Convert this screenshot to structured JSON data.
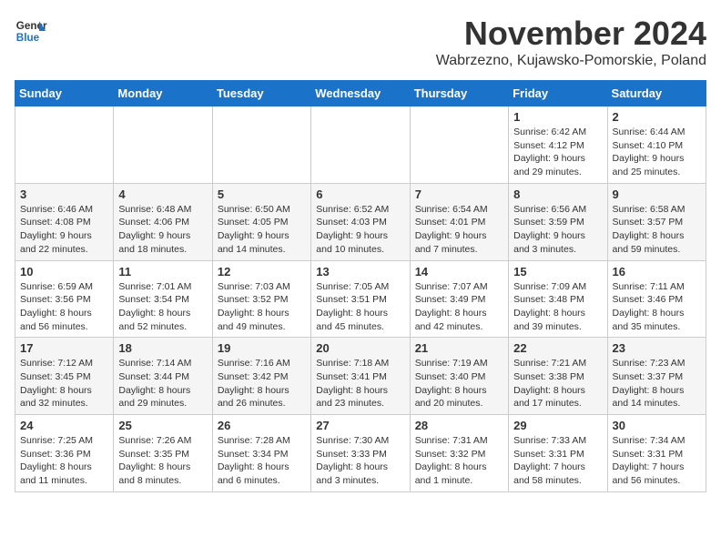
{
  "logo": {
    "line1": "General",
    "line2": "Blue"
  },
  "title": "November 2024",
  "location": "Wabrzezno, Kujawsko-Pomorskie, Poland",
  "weekdays": [
    "Sunday",
    "Monday",
    "Tuesday",
    "Wednesday",
    "Thursday",
    "Friday",
    "Saturday"
  ],
  "weeks": [
    [
      {
        "day": "",
        "info": ""
      },
      {
        "day": "",
        "info": ""
      },
      {
        "day": "",
        "info": ""
      },
      {
        "day": "",
        "info": ""
      },
      {
        "day": "",
        "info": ""
      },
      {
        "day": "1",
        "info": "Sunrise: 6:42 AM\nSunset: 4:12 PM\nDaylight: 9 hours and 29 minutes."
      },
      {
        "day": "2",
        "info": "Sunrise: 6:44 AM\nSunset: 4:10 PM\nDaylight: 9 hours and 25 minutes."
      }
    ],
    [
      {
        "day": "3",
        "info": "Sunrise: 6:46 AM\nSunset: 4:08 PM\nDaylight: 9 hours and 22 minutes."
      },
      {
        "day": "4",
        "info": "Sunrise: 6:48 AM\nSunset: 4:06 PM\nDaylight: 9 hours and 18 minutes."
      },
      {
        "day": "5",
        "info": "Sunrise: 6:50 AM\nSunset: 4:05 PM\nDaylight: 9 hours and 14 minutes."
      },
      {
        "day": "6",
        "info": "Sunrise: 6:52 AM\nSunset: 4:03 PM\nDaylight: 9 hours and 10 minutes."
      },
      {
        "day": "7",
        "info": "Sunrise: 6:54 AM\nSunset: 4:01 PM\nDaylight: 9 hours and 7 minutes."
      },
      {
        "day": "8",
        "info": "Sunrise: 6:56 AM\nSunset: 3:59 PM\nDaylight: 9 hours and 3 minutes."
      },
      {
        "day": "9",
        "info": "Sunrise: 6:58 AM\nSunset: 3:57 PM\nDaylight: 8 hours and 59 minutes."
      }
    ],
    [
      {
        "day": "10",
        "info": "Sunrise: 6:59 AM\nSunset: 3:56 PM\nDaylight: 8 hours and 56 minutes."
      },
      {
        "day": "11",
        "info": "Sunrise: 7:01 AM\nSunset: 3:54 PM\nDaylight: 8 hours and 52 minutes."
      },
      {
        "day": "12",
        "info": "Sunrise: 7:03 AM\nSunset: 3:52 PM\nDaylight: 8 hours and 49 minutes."
      },
      {
        "day": "13",
        "info": "Sunrise: 7:05 AM\nSunset: 3:51 PM\nDaylight: 8 hours and 45 minutes."
      },
      {
        "day": "14",
        "info": "Sunrise: 7:07 AM\nSunset: 3:49 PM\nDaylight: 8 hours and 42 minutes."
      },
      {
        "day": "15",
        "info": "Sunrise: 7:09 AM\nSunset: 3:48 PM\nDaylight: 8 hours and 39 minutes."
      },
      {
        "day": "16",
        "info": "Sunrise: 7:11 AM\nSunset: 3:46 PM\nDaylight: 8 hours and 35 minutes."
      }
    ],
    [
      {
        "day": "17",
        "info": "Sunrise: 7:12 AM\nSunset: 3:45 PM\nDaylight: 8 hours and 32 minutes."
      },
      {
        "day": "18",
        "info": "Sunrise: 7:14 AM\nSunset: 3:44 PM\nDaylight: 8 hours and 29 minutes."
      },
      {
        "day": "19",
        "info": "Sunrise: 7:16 AM\nSunset: 3:42 PM\nDaylight: 8 hours and 26 minutes."
      },
      {
        "day": "20",
        "info": "Sunrise: 7:18 AM\nSunset: 3:41 PM\nDaylight: 8 hours and 23 minutes."
      },
      {
        "day": "21",
        "info": "Sunrise: 7:19 AM\nSunset: 3:40 PM\nDaylight: 8 hours and 20 minutes."
      },
      {
        "day": "22",
        "info": "Sunrise: 7:21 AM\nSunset: 3:38 PM\nDaylight: 8 hours and 17 minutes."
      },
      {
        "day": "23",
        "info": "Sunrise: 7:23 AM\nSunset: 3:37 PM\nDaylight: 8 hours and 14 minutes."
      }
    ],
    [
      {
        "day": "24",
        "info": "Sunrise: 7:25 AM\nSunset: 3:36 PM\nDaylight: 8 hours and 11 minutes."
      },
      {
        "day": "25",
        "info": "Sunrise: 7:26 AM\nSunset: 3:35 PM\nDaylight: 8 hours and 8 minutes."
      },
      {
        "day": "26",
        "info": "Sunrise: 7:28 AM\nSunset: 3:34 PM\nDaylight: 8 hours and 6 minutes."
      },
      {
        "day": "27",
        "info": "Sunrise: 7:30 AM\nSunset: 3:33 PM\nDaylight: 8 hours and 3 minutes."
      },
      {
        "day": "28",
        "info": "Sunrise: 7:31 AM\nSunset: 3:32 PM\nDaylight: 8 hours and 1 minute."
      },
      {
        "day": "29",
        "info": "Sunrise: 7:33 AM\nSunset: 3:31 PM\nDaylight: 7 hours and 58 minutes."
      },
      {
        "day": "30",
        "info": "Sunrise: 7:34 AM\nSunset: 3:31 PM\nDaylight: 7 hours and 56 minutes."
      }
    ]
  ]
}
